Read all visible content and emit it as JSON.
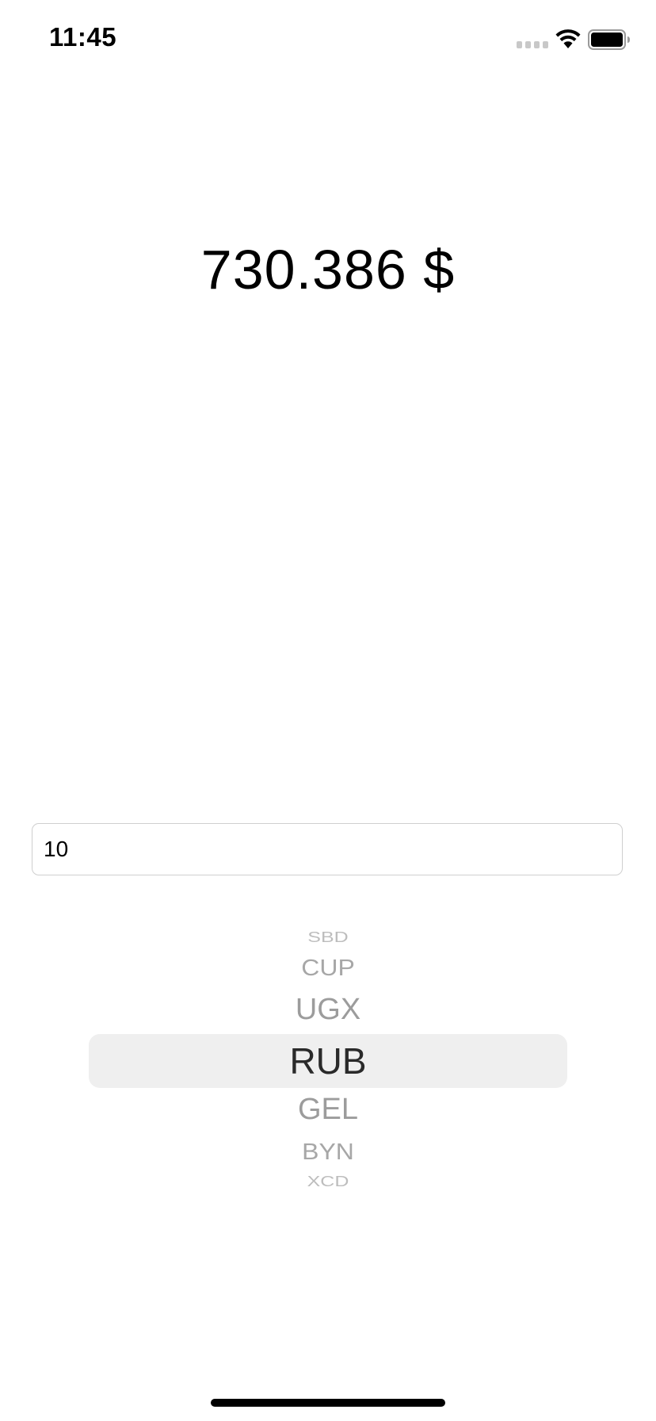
{
  "status_bar": {
    "time": "11:45",
    "icons": [
      "cellular-signal-icon",
      "wifi-icon",
      "battery-icon"
    ]
  },
  "result": {
    "text": "730.386 $"
  },
  "amount_input": {
    "value": "10",
    "placeholder": ""
  },
  "currency_picker": {
    "selected": "RUB",
    "visible_options": [
      "SBD",
      "CUP",
      "UGX",
      "RUB",
      "GEL",
      "BYN",
      "XCD"
    ]
  },
  "colors": {
    "background": "#ffffff",
    "text": "#000000",
    "picker_selection": "#efefef",
    "picker_unselected_text": "#a7a7a7"
  }
}
